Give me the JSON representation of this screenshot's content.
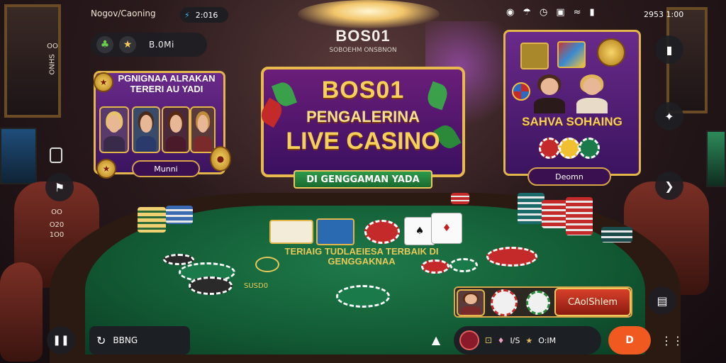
{
  "status_bar": {
    "app_label": "Nogov/Caoning",
    "pill_value": "2:016",
    "clock": "2953 1:00"
  },
  "top_left": {
    "label": "B.0Mi"
  },
  "brand": {
    "title": "BOS01",
    "subtitle": "SOBOEHM ONSBNON"
  },
  "left_panel": {
    "title": "PGNIGNAA ALRAKAN TERERI AU YADI",
    "button_label": "Munni"
  },
  "main_banner": {
    "line1": "BOS01",
    "line2": "PENGALERINA",
    "line3": "LIVE CASINO",
    "ribbon": "DI GENGGAMAN YADA"
  },
  "right_panel": {
    "title": "SAHVA SOHAING",
    "button_label": "Deomn"
  },
  "left_side": {
    "labels": [
      "OO",
      "ONHS",
      "OO",
      "O20",
      "1O0"
    ]
  },
  "table": {
    "felt_text": "TERIAIG TUDLAEIESA TERBAIK DI GENGGAKNAA",
    "felt_small": "SUSD0",
    "cards": [
      "♠",
      "♦"
    ]
  },
  "action_bar": {
    "button_label": "CAolShlem"
  },
  "bottom_bar": {
    "left_pill_label": "BBNG",
    "right_pill_value1": "I/S",
    "right_pill_value2": "O:IM"
  },
  "colors": {
    "accent_gold": "#e3b64c",
    "panel_purple": "#6a2a8a",
    "felt_green": "#1f7a4a",
    "orange": "#f05a20"
  }
}
